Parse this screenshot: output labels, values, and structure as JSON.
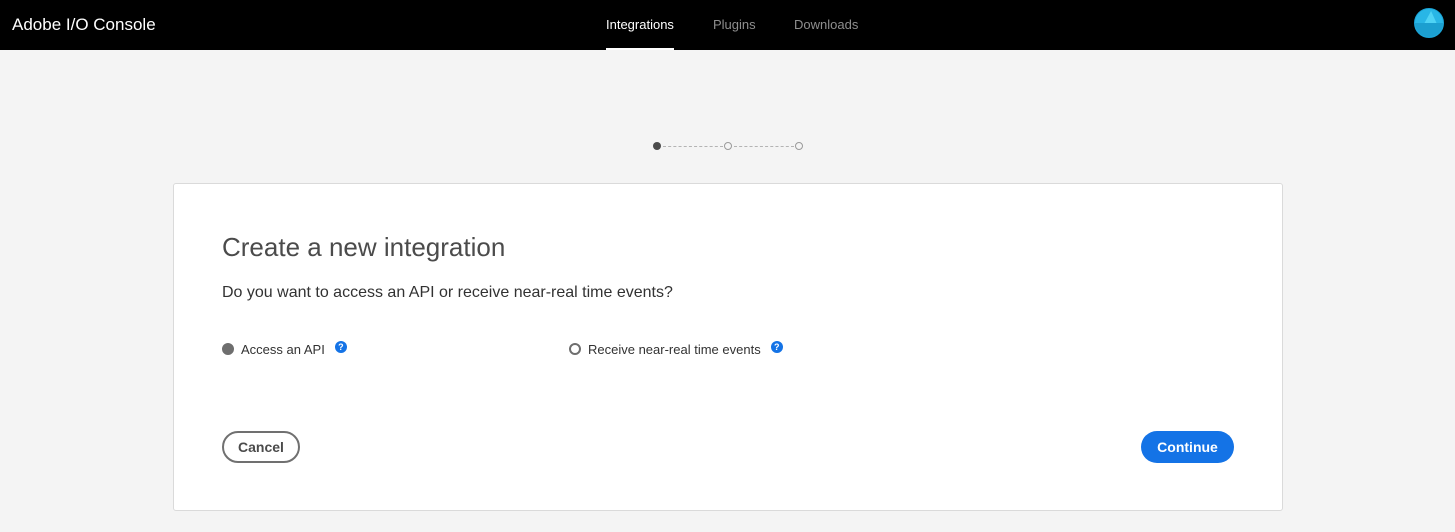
{
  "app": {
    "title": "Adobe I/O Console"
  },
  "nav": {
    "items": [
      {
        "label": "Integrations",
        "active": true
      },
      {
        "label": "Plugins",
        "active": false
      },
      {
        "label": "Downloads",
        "active": false
      }
    ]
  },
  "user": {
    "avatar_icon": "user-avatar-icon",
    "avatar_color": "#29b6e6"
  },
  "stepper": {
    "total_steps": 3,
    "current_step": 1
  },
  "wizard": {
    "title": "Create a new integration",
    "question": "Do you want to access an API or receive near-real time events?",
    "options": [
      {
        "label": "Access an API",
        "selected": true,
        "help_icon": "help-icon"
      },
      {
        "label": "Receive near-real time events",
        "selected": false,
        "help_icon": "help-icon"
      }
    ],
    "help_glyph": "?",
    "cancel_label": "Cancel",
    "continue_label": "Continue"
  },
  "colors": {
    "topbar": "#000000",
    "accent": "#1473e6",
    "background": "#f4f4f4"
  }
}
